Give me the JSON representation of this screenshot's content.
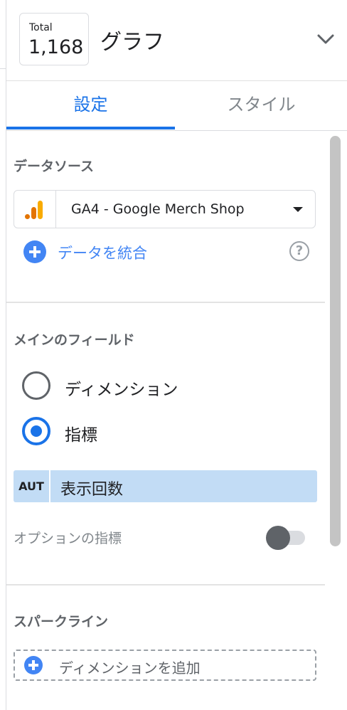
{
  "header": {
    "total_label": "Total",
    "total_value": "1,168",
    "chart_title": "グラフ",
    "collapse_icon": "chevron-down-icon"
  },
  "tabs": [
    {
      "label": "設定",
      "active": true
    },
    {
      "label": "スタイル",
      "active": false
    }
  ],
  "data_source": {
    "section_title": "データソース",
    "source_name": "GA4 - Google Merch Shop",
    "source_icon": "analytics-bars-icon",
    "blend_label": "データを統合",
    "help_icon": "help-icon"
  },
  "primary_field": {
    "section_title": "メインのフィールド",
    "options": [
      {
        "label": "ディメンション",
        "selected": false
      },
      {
        "label": "指標",
        "selected": true
      }
    ],
    "metric": {
      "type_label": "AUT",
      "name": "表示回数"
    },
    "optional_metrics_label": "オプションの指標",
    "optional_metrics_enabled": false
  },
  "sparkline": {
    "section_title": "スパークライン",
    "add_dimension_label": "ディメンションを追加"
  },
  "colors": {
    "accent": "#1a73e8",
    "plus_blue": "#4285f4",
    "metric_chip": "#c2dcf5",
    "ga_orange": "#f29900"
  }
}
